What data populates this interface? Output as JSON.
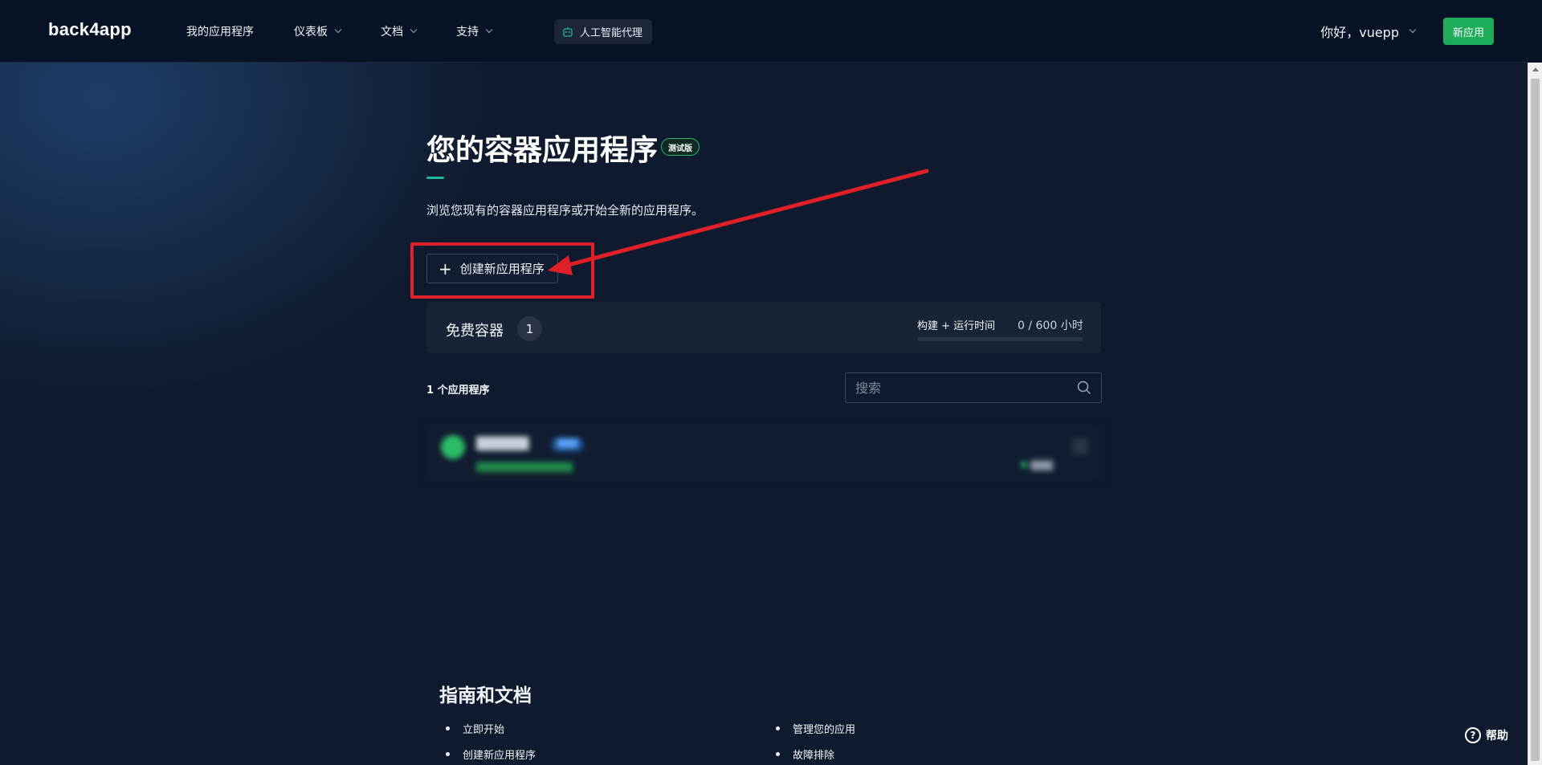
{
  "header": {
    "logo": "back4app",
    "nav": [
      {
        "label": "我的应用程序",
        "has_dropdown": false
      },
      {
        "label": "仪表板",
        "has_dropdown": true
      },
      {
        "label": "文档",
        "has_dropdown": true
      },
      {
        "label": "支持",
        "has_dropdown": true
      }
    ],
    "ai_agent_label": "人工智能代理",
    "greeting": "你好，vuepp",
    "new_app_label": "新应用"
  },
  "main": {
    "title": "您的容器应用程序",
    "beta_badge": "测试版",
    "subtitle": "浏览您现有的容器应用程序或开始全新的应用程序。",
    "create_button_label": "创建新应用程序",
    "free_containers": {
      "label": "免费容器",
      "count": "1",
      "build_label": "构建 + 运行时间",
      "build_value": "0 / 600 小时",
      "progress_percent": 0
    },
    "apps_count_label": "1 个应用程序",
    "search_placeholder": "搜索"
  },
  "guides": {
    "title": "指南和文档",
    "left_items": [
      "立即开始",
      "创建新应用程序"
    ],
    "right_items": [
      "管理您的应用",
      "故障排除"
    ]
  },
  "help_label": "帮助",
  "colors": {
    "accent_green": "#1eac5a",
    "annotation_red": "#e02029",
    "background": "#0f1a2e"
  }
}
